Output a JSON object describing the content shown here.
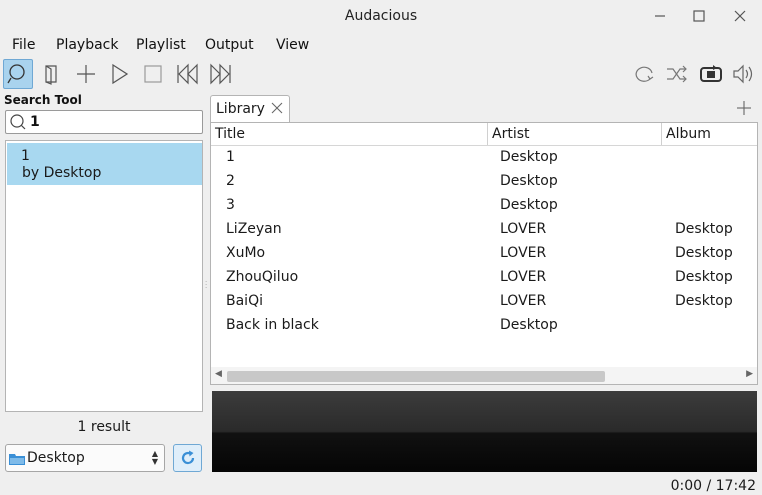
{
  "window": {
    "title": "Audacious"
  },
  "menu": [
    "File",
    "Playback",
    "Playlist",
    "Output",
    "View"
  ],
  "toolbar": {
    "left_icons": [
      "search-tool-icon",
      "open-files-icon",
      "add-files-icon",
      "play-icon",
      "stop-icon",
      "previous-icon",
      "next-icon"
    ],
    "right_icons": [
      "repeat-icon",
      "shuffle-icon",
      "stop-after-this-song-icon",
      "volume-icon"
    ]
  },
  "search_tool": {
    "title": "Search Tool",
    "query": "1",
    "results": [
      {
        "line1": "1",
        "line2": "by Desktop"
      }
    ],
    "result_count": "1 result",
    "source": "Desktop"
  },
  "playlist": {
    "tab_label": "Library",
    "columns": [
      "Title",
      "Artist",
      "Album"
    ],
    "rows": [
      {
        "title": "1",
        "artist": "Desktop",
        "album": ""
      },
      {
        "title": "2",
        "artist": "Desktop",
        "album": ""
      },
      {
        "title": "3",
        "artist": "Desktop",
        "album": ""
      },
      {
        "title": "LiZeyan",
        "artist": "LOVER",
        "album": "Desktop"
      },
      {
        "title": "XuMo",
        "artist": "LOVER",
        "album": "Desktop"
      },
      {
        "title": "ZhouQiluo",
        "artist": "LOVER",
        "album": "Desktop"
      },
      {
        "title": "BaiQi",
        "artist": "LOVER",
        "album": "Desktop"
      },
      {
        "title": "Back in black",
        "artist": "Desktop",
        "album": ""
      }
    ]
  },
  "status": {
    "time": "0:00 / 17:42"
  },
  "colors": {
    "selection": "#a8d8f0",
    "accent": "#3a8fd6"
  }
}
